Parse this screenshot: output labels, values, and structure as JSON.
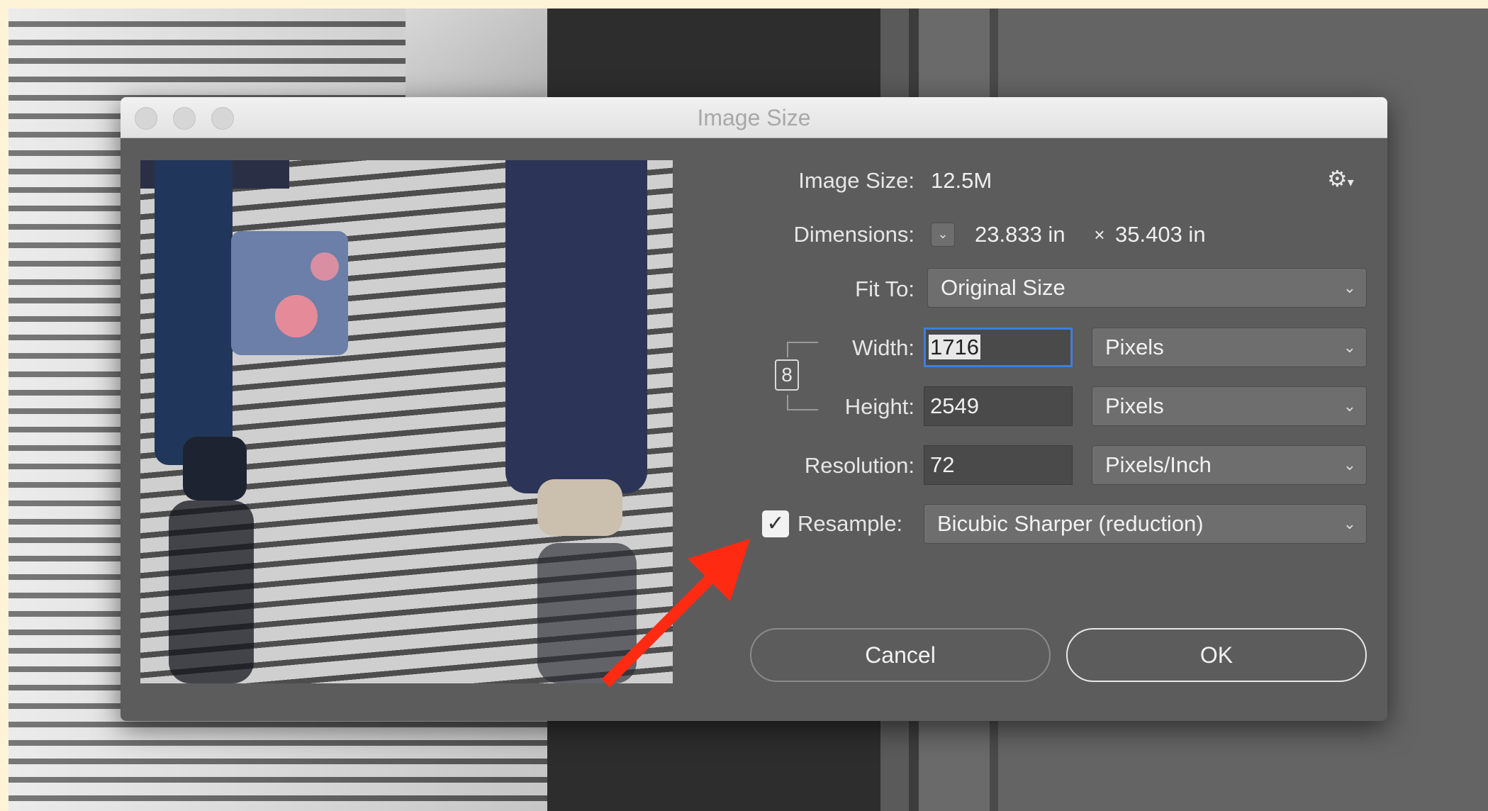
{
  "dialog": {
    "title": "Image Size",
    "image_size_label": "Image Size:",
    "image_size_value": "12.5M",
    "dimensions_label": "Dimensions:",
    "dimensions_width": "23.833 in",
    "dimensions_times": "×",
    "dimensions_height": "35.403 in",
    "fit_to_label": "Fit To:",
    "fit_to_value": "Original Size",
    "width_label": "Width:",
    "width_value": "1716",
    "width_unit": "Pixels",
    "height_label": "Height:",
    "height_value": "2549",
    "height_unit": "Pixels",
    "resolution_label": "Resolution:",
    "resolution_value": "72",
    "resolution_unit": "Pixels/Inch",
    "resample_label": "Resample:",
    "resample_checked": "✓",
    "resample_value": "Bicubic Sharper (reduction)",
    "cancel_label": "Cancel",
    "ok_label": "OK"
  },
  "icons": {
    "gear": "⚙",
    "chevron": "⌄",
    "link": "8"
  },
  "colors": {
    "dialog_bg": "#5c5c5c",
    "focus_ring": "#3d7fdc",
    "arrow": "#ff2a12"
  }
}
